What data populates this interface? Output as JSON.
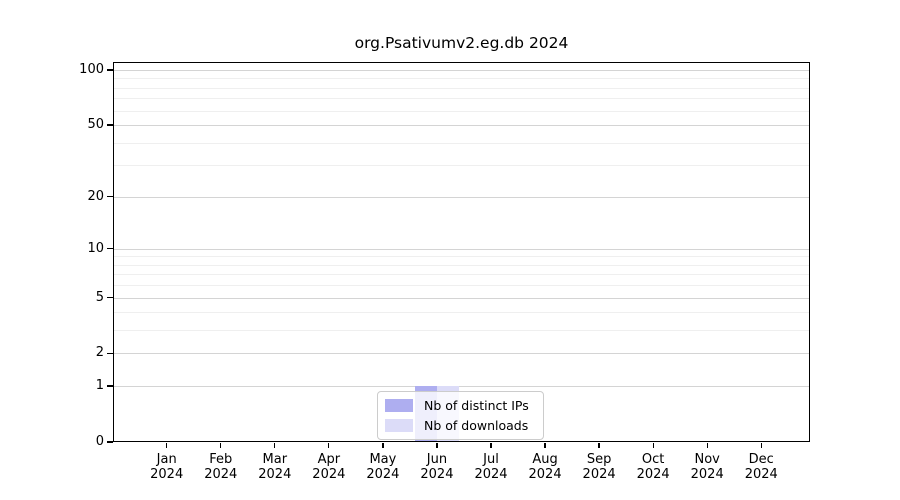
{
  "chart_data": {
    "type": "bar",
    "title": "org.Psativumv2.eg.db 2024",
    "year_label": "2024",
    "categories": [
      "Jan",
      "Feb",
      "Mar",
      "Apr",
      "May",
      "Jun",
      "Jul",
      "Aug",
      "Sep",
      "Oct",
      "Nov",
      "Dec"
    ],
    "series": [
      {
        "name": "Nb of distinct IPs",
        "color": "#aeaef0",
        "values": [
          0,
          0,
          0,
          0,
          0,
          1,
          0,
          0,
          0,
          0,
          0,
          0
        ]
      },
      {
        "name": "Nb of downloads",
        "color": "#dcdcf8",
        "values": [
          0,
          0,
          0,
          0,
          0,
          1,
          0,
          0,
          0,
          0,
          0,
          0
        ]
      }
    ],
    "y_scale": "log1p",
    "ylim": [
      0,
      100
    ],
    "y_major_ticks": [
      0,
      1,
      2,
      5,
      10,
      20,
      50,
      100
    ],
    "y_minor_ticks": [
      3,
      4,
      6,
      7,
      8,
      9,
      30,
      40,
      60,
      70,
      80,
      90
    ],
    "xlabel": "",
    "ylabel": "",
    "grid": "horizontal",
    "legend_position": "bottom-center",
    "colors": {
      "axis": "#000000",
      "grid_major": "#d4d4d4",
      "grid_minor": "#efefef",
      "background": "#ffffff"
    }
  }
}
